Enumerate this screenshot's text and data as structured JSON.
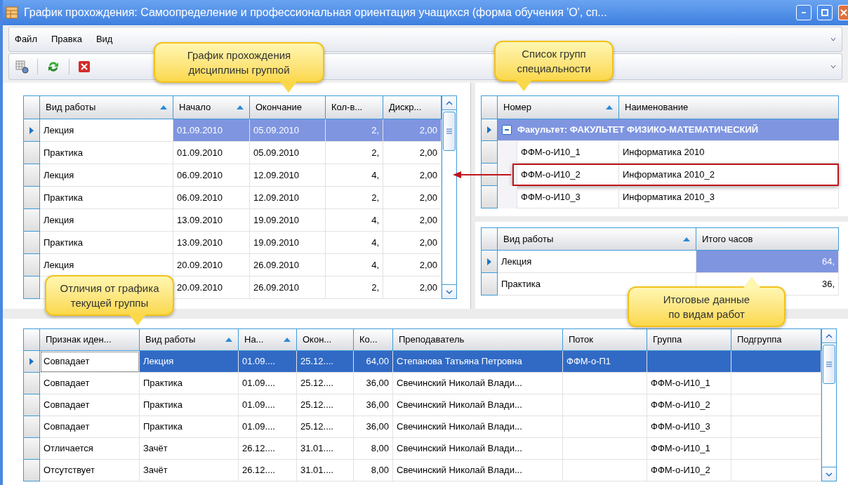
{
  "window": {
    "title": "График прохождения: Самоопределение и профессиональная ориентация учащихся (форма обучения 'О', сп..."
  },
  "menu": [
    {
      "label": "Файл"
    },
    {
      "label": "Правка"
    },
    {
      "label": "Вид"
    }
  ],
  "schedule": {
    "columns": [
      {
        "label": "Вид работы",
        "sorted": true
      },
      {
        "label": "Начало",
        "sorted": true
      },
      {
        "label": "Окончание",
        "sorted": false
      },
      {
        "label": "Кол-в...",
        "sorted": false
      },
      {
        "label": "Дискр...",
        "sorted": false
      }
    ],
    "rows": [
      {
        "selected": true,
        "cells": [
          "Лекция",
          "01.09.2010",
          "05.09.2010",
          "2,",
          "2,00"
        ]
      },
      {
        "selected": false,
        "cells": [
          "Практика",
          "01.09.2010",
          "05.09.2010",
          "2,",
          "2,00"
        ]
      },
      {
        "selected": false,
        "cells": [
          "Лекция",
          "06.09.2010",
          "12.09.2010",
          "4,",
          "2,00"
        ]
      },
      {
        "selected": false,
        "cells": [
          "Практика",
          "06.09.2010",
          "12.09.2010",
          "2,",
          "2,00"
        ]
      },
      {
        "selected": false,
        "cells": [
          "Лекция",
          "13.09.2010",
          "19.09.2010",
          "4,",
          "2,00"
        ]
      },
      {
        "selected": false,
        "cells": [
          "Практика",
          "13.09.2010",
          "19.09.2010",
          "4,",
          "2,00"
        ]
      },
      {
        "selected": false,
        "cells": [
          "Лекция",
          "20.09.2010",
          "26.09.2010",
          "4,",
          "2,00"
        ]
      },
      {
        "selected": false,
        "cells": [
          null,
          "20.09.2010",
          "26.09.2010",
          "2,",
          "2,00"
        ]
      }
    ]
  },
  "groups": {
    "columns": [
      {
        "label": "Номер",
        "sorted": true
      },
      {
        "label": "Наименование",
        "sorted": false
      }
    ],
    "rows": [
      {
        "kind": "group",
        "text": "Факультет: ФАКУЛЬТЕТ ФИЗИКО-МАТЕМАТИЧЕСКИЙ",
        "expanded": true,
        "selected": true,
        "children": [
          {
            "selected": false,
            "highlighted": false,
            "cells": [
              "ФФМ-о-И10_1",
              "Информатика 2010"
            ]
          },
          {
            "selected": false,
            "highlighted": true,
            "cells": [
              "ФФМ-о-И10_2",
              "Информатика 2010_2"
            ]
          },
          {
            "selected": false,
            "highlighted": false,
            "cells": [
              "ФФМ-о-И10_3",
              "Информатика 2010_3"
            ]
          }
        ]
      }
    ]
  },
  "totals": {
    "columns": [
      {
        "label": "Вид работы",
        "sorted": true
      },
      {
        "label": "Итого часов",
        "sorted": false
      }
    ],
    "rows": [
      {
        "selected": true,
        "cells": [
          "Лекция",
          "64,"
        ]
      },
      {
        "selected": false,
        "cells": [
          "Практика",
          "36,"
        ]
      }
    ]
  },
  "differences": {
    "columns": [
      {
        "label": "Признак иден...",
        "sorted": false
      },
      {
        "label": "Вид работы",
        "sorted": true
      },
      {
        "label": "На...",
        "sorted": true
      },
      {
        "label": "Окон...",
        "sorted": false
      },
      {
        "label": "Ко...",
        "sorted": false
      },
      {
        "label": "Преподаватель",
        "sorted": false
      },
      {
        "label": "Поток",
        "sorted": false
      },
      {
        "label": "Группа",
        "sorted": false
      },
      {
        "label": "Подгруппа",
        "sorted": false
      }
    ],
    "rows": [
      {
        "selected": true,
        "cells": [
          "Совпадает",
          "Лекция",
          "01.09....",
          "25.12....",
          "64,00",
          "Степанова Татьяна Петровна",
          "ФФМ-о-П1",
          null,
          null
        ]
      },
      {
        "selected": false,
        "cells": [
          "Совпадает",
          "Практика",
          "01.09....",
          "25.12....",
          "36,00",
          "Свечинский Николай Влади...",
          null,
          "ФФМ-о-И10_1",
          null
        ]
      },
      {
        "selected": false,
        "cells": [
          "Совпадает",
          "Практика",
          "01.09....",
          "25.12....",
          "36,00",
          "Свечинский Николай Влади...",
          null,
          "ФФМ-о-И10_2",
          null
        ]
      },
      {
        "selected": false,
        "cells": [
          "Совпадает",
          "Практика",
          "01.09....",
          "25.12....",
          "36,00",
          "Свечинский Николай Влади...",
          null,
          "ФФМ-о-И10_3",
          null
        ]
      },
      {
        "selected": false,
        "cells": [
          "Отличается",
          "Зачёт",
          "26.12....",
          "31.01....",
          "8,00",
          "Свечинский Николай Влади...",
          null,
          "ФФМ-о-И10_1",
          null
        ]
      },
      {
        "selected": false,
        "cells": [
          "Отсутствует",
          "Зачёт",
          "26.12....",
          "31.01....",
          "8,00",
          "Свечинский Николай Влади...",
          null,
          "ФФМ-о-И10_2",
          null
        ]
      }
    ]
  },
  "callouts": [
    {
      "text": "График прохождения\nдисциплины группой"
    },
    {
      "text": "Список групп\nспециальности"
    },
    {
      "text": "Отличия от графика\nтекущей группы"
    },
    {
      "text": "Итоговые данные\nпо видам работ"
    }
  ]
}
